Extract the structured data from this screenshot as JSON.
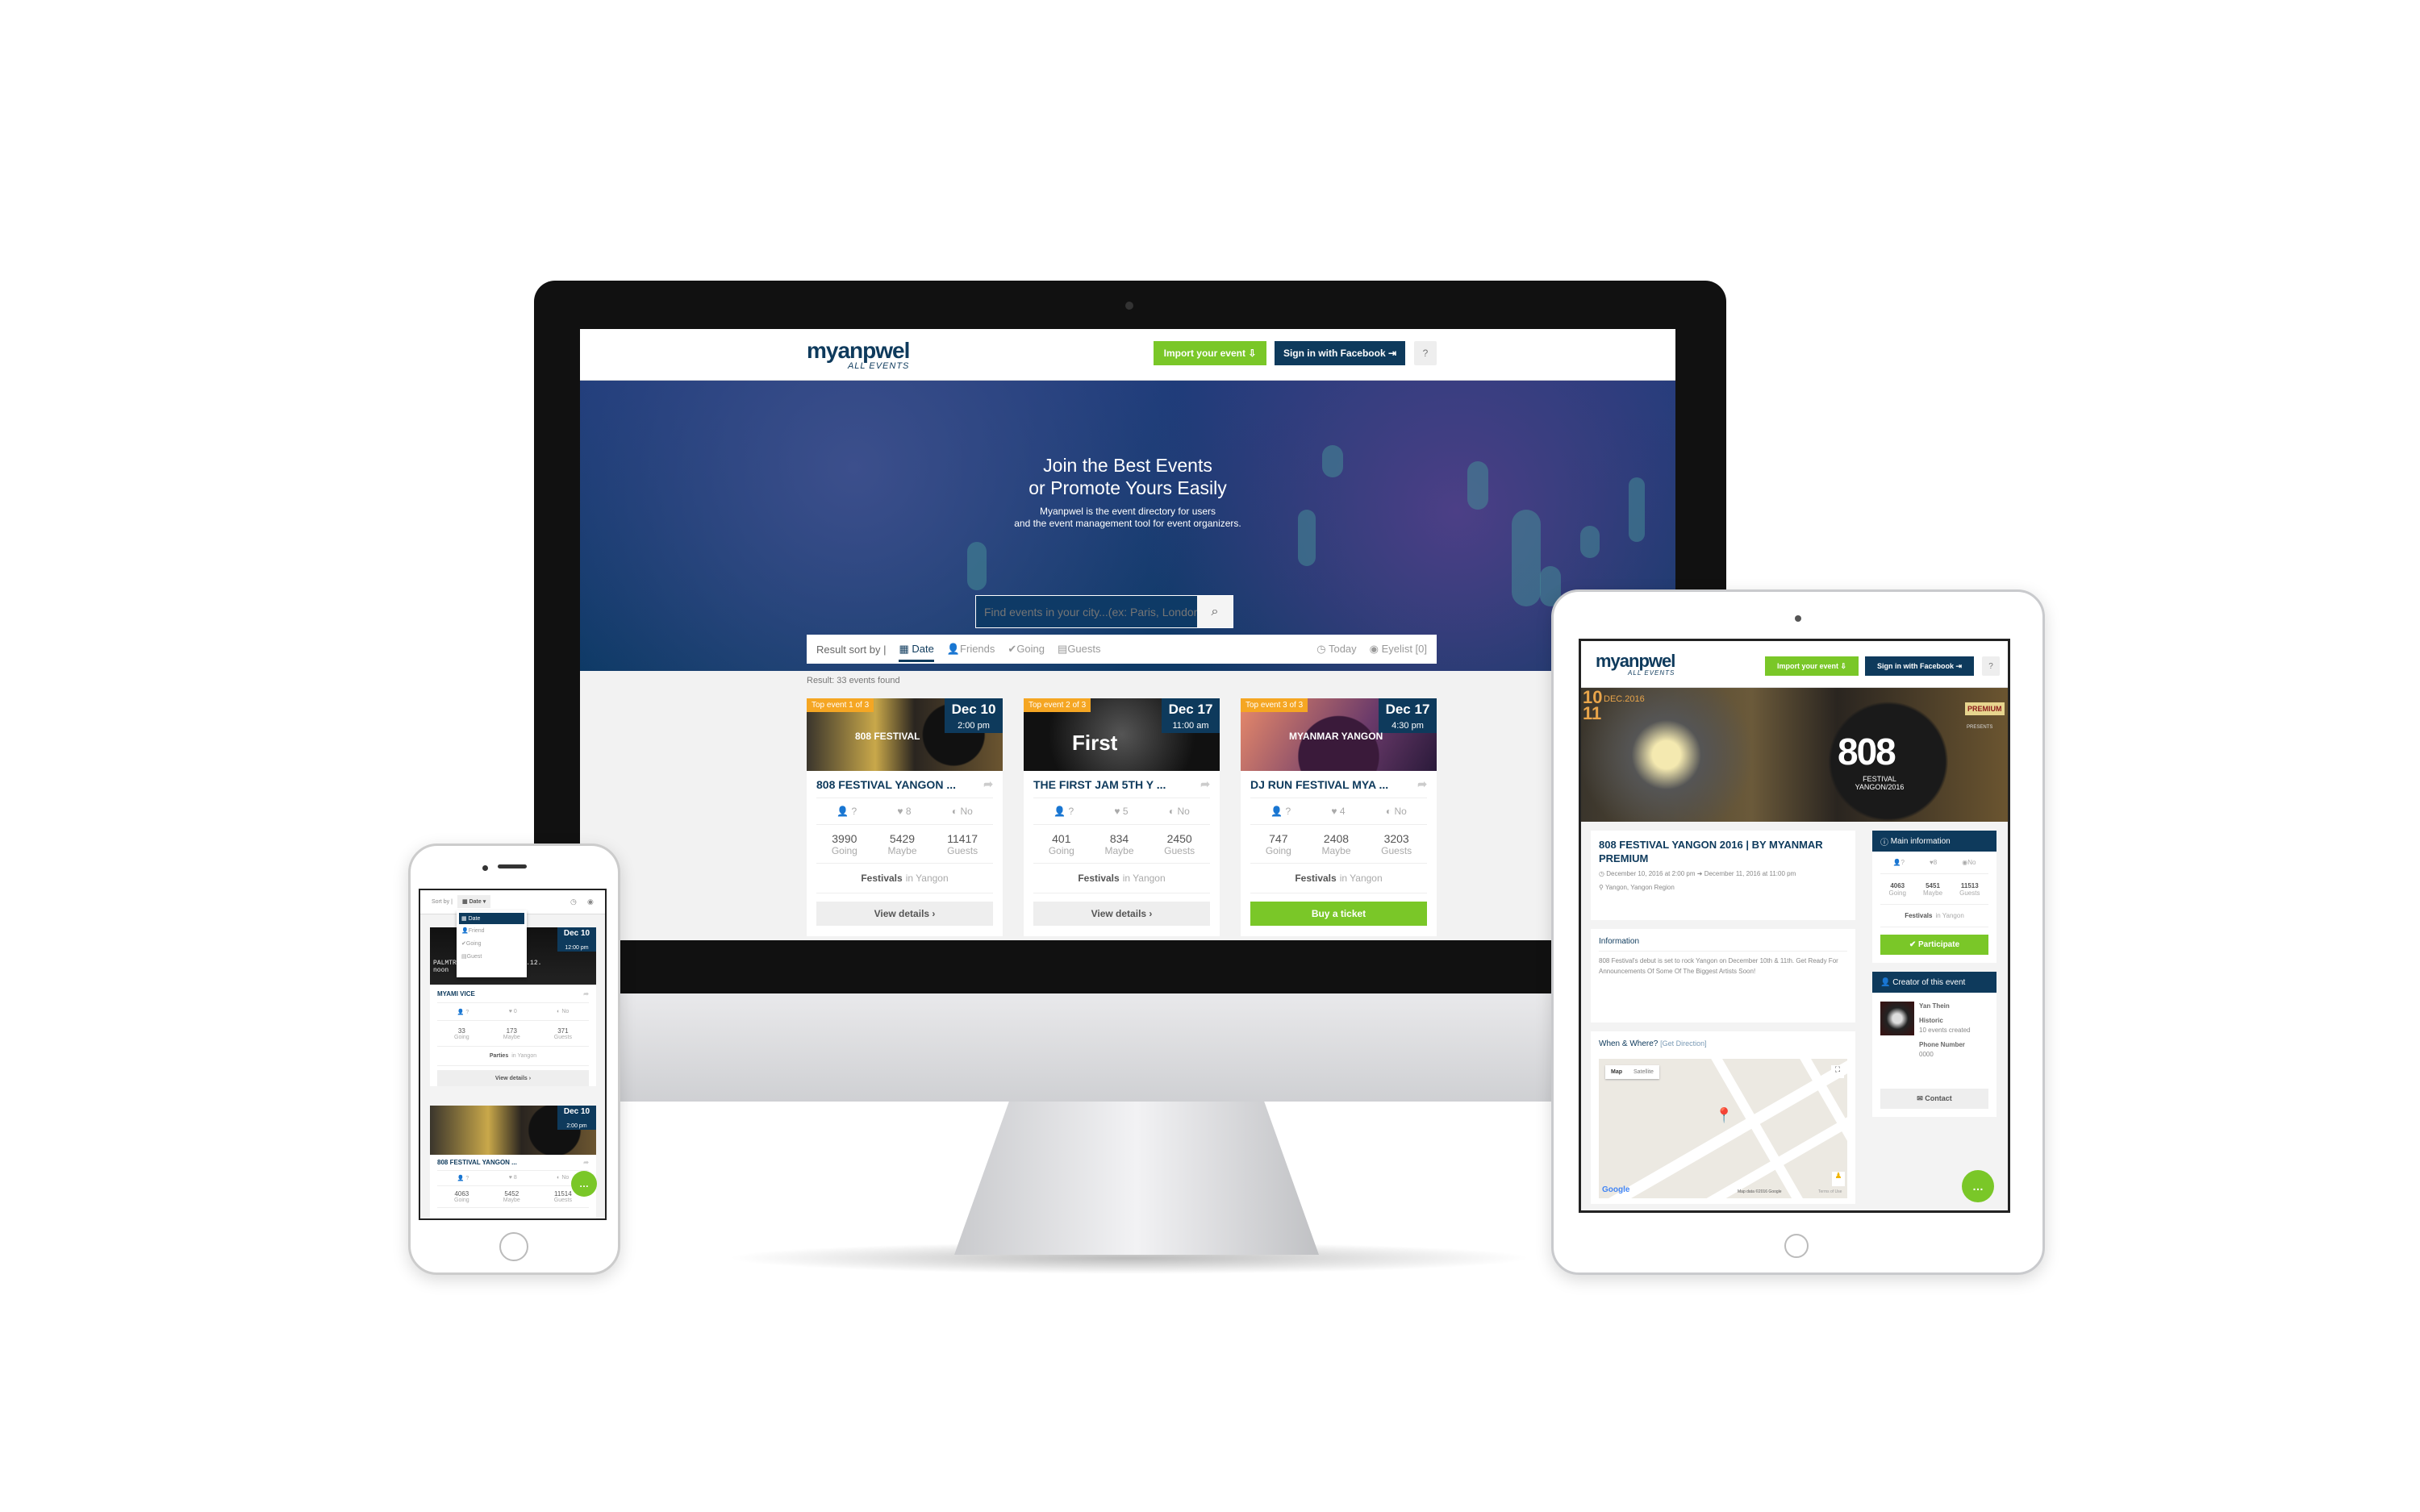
{
  "monitor": {
    "header": {
      "logo_main": "myanpwel",
      "logo_sub": "ALL EVENTS",
      "import_label": "Import your event",
      "signin_label": "Sign in with Facebook",
      "help_icon": "?"
    },
    "hero": {
      "title_line1": "Join the Best Events",
      "title_line2": "or Promote Yours Easily",
      "subtitle_line1": "Myanpwel is the event directory for users",
      "subtitle_line2": "and the event management tool for event organizers.",
      "search_placeholder": "Find events in your city...(ex: Paris, London,...)"
    },
    "sort": {
      "label": "Result sort by |",
      "options": [
        "Date",
        "Friends",
        "Going",
        "Guests"
      ],
      "today": "Today",
      "eyelist": "Eyelist [0]"
    },
    "result_text": "Result: 33 events found",
    "stat_labels": {
      "going": "Going",
      "maybe": "Maybe",
      "guests": "Guests"
    },
    "cards": [
      {
        "badge": "Top event 1 of 3",
        "date": "Dec 10",
        "time": "2:00 pm",
        "title": "808 FESTIVAL YANGON ...",
        "friends": "?",
        "likes": "8",
        "seen": "No",
        "going": "3990",
        "maybe": "5429",
        "guests": "11417",
        "category": "Festivals",
        "location": "in Yangon",
        "button": "View details ›"
      },
      {
        "badge": "Top event 2 of 3",
        "date": "Dec 17",
        "time": "11:00 am",
        "title": "THE FIRST JAM 5TH Y ...",
        "friends": "?",
        "likes": "5",
        "seen": "No",
        "going": "401",
        "maybe": "834",
        "guests": "2450",
        "category": "Festivals",
        "location": "in Yangon",
        "button": "View details ›"
      },
      {
        "badge": "Top event 3 of 3",
        "date": "Dec 17",
        "time": "4:30 pm",
        "title": "DJ RUN FESTIVAL MYA ...",
        "friends": "?",
        "likes": "4",
        "seen": "No",
        "going": "747",
        "maybe": "2408",
        "guests": "3203",
        "category": "Festivals",
        "location": "in Yangon",
        "button": "Buy a ticket"
      }
    ],
    "card_image_text": [
      "808 FESTIVAL",
      "First",
      "MYANMAR YANGON"
    ]
  },
  "tablet": {
    "header": {
      "logo_main": "myanpwel",
      "logo_sub": "ALL EVENTS",
      "import_label": "Import your event",
      "signin_label": "Sign in with Facebook",
      "help_icon": "?"
    },
    "banner": {
      "dates": "10 11",
      "month": "DEC.2016",
      "sponsor": "PREMIUM",
      "presents": "PRESENTS",
      "logo": "808",
      "festival": "FESTIVAL YANGON/2016"
    },
    "event": {
      "title": "808 FESTIVAL YANGON 2016 | BY MYANMAR PREMIUM",
      "start": "December 10, 2016 at 2:00 pm",
      "end": "December 11, 2016 at 11:00 pm",
      "location": "Yangon, Yangon Region",
      "info_heading": "Information",
      "info_text": "808 Festival's debut is set to rock Yangon on December 10th & 11th. Get Ready For Announcements Of Some Of The Biggest Artists Soon!",
      "where_heading": "When & Where?",
      "get_direction": "[Get Direction]",
      "map_tab_map": "Map",
      "map_tab_satellite": "Satellite",
      "google": "Google",
      "map_attribution": "Map data ©2016 Google",
      "terms": "Terms of Use"
    },
    "sidebar": {
      "main_info": "Main information",
      "friends": "?",
      "likes": "8",
      "seen": "No",
      "going": "4063",
      "maybe": "5451",
      "guests": "11513",
      "going_label": "Going",
      "maybe_label": "Maybe",
      "guests_label": "Guests",
      "category": "Festivals",
      "location": "in Yangon",
      "participate": "✔ Participate",
      "creator_heading": "Creator of this event",
      "creator_name": "Yan Thein",
      "historic": "Historic",
      "events_created": "10 events created",
      "phone_label": "Phone Number",
      "phone": "0000",
      "contact": "✉ Contact"
    }
  },
  "phone": {
    "sort_label": "Sort by |",
    "selected": "Date",
    "dropdown": [
      "Date",
      "Friend",
      "Going",
      "Guest"
    ],
    "stat_labels": {
      "going": "Going",
      "maybe": "Maybe",
      "guests": "Guests"
    },
    "cards": [
      {
        "date": "Dec 10",
        "time": "12:00 pm",
        "title": "MYAMI VICE",
        "friends": "?",
        "likes": "0",
        "seen": "No",
        "going": "33",
        "maybe": "173",
        "guests": "371",
        "category": "Parties",
        "location": "in Yangon",
        "button": "View details ›"
      },
      {
        "date": "Dec 10",
        "time": "2:00 pm",
        "title": "808 FESTIVAL YANGON ...",
        "friends": "?",
        "likes": "8",
        "seen": "No",
        "going": "4063",
        "maybe": "5452",
        "guests": "11514",
        "category": "",
        "location": "",
        "button": ""
      }
    ],
    "card_image_text": "PALMTREES 10.12. noon 11.12. noon"
  },
  "colors": {
    "navy": "#0e3a5c",
    "green": "#7ac728",
    "badge": "#f5a623"
  }
}
